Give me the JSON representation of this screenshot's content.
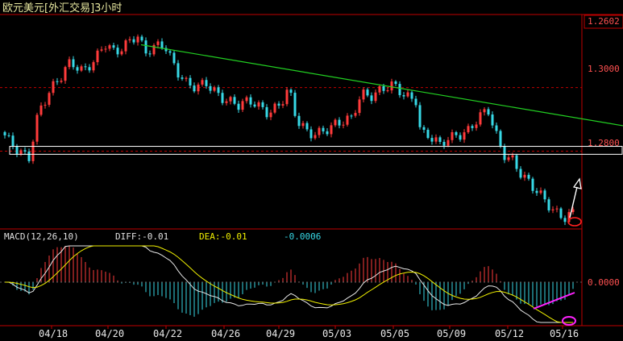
{
  "title": "欧元美元[外汇交易]3小时",
  "colors": {
    "frame": "#c00000",
    "up": "#ff3b3b",
    "down": "#37d9e6",
    "trendline": "#22d022",
    "diff": "#e8e8e8",
    "dea": "#f0f000",
    "title": "#e8e8a0",
    "macd_label": "#e0e0e0",
    "diff_label": "#e0e0e0",
    "dea_label": "#f0f000",
    "macd_value_label": "#37d9e6",
    "price_axis": "#ff5050",
    "annotation_white": "#ffffff",
    "annotation_magenta": "#ff22ff"
  },
  "chart_data": [
    {
      "type": "candlestick",
      "title": "欧元美元[外汇交易]3小时",
      "current_price": "1.2602",
      "y_ticks": [
        "1.3000",
        "1.2800"
      ],
      "ylim": [
        1.256,
        1.322
      ],
      "x_tick_labels": [
        "04/18",
        "04/20",
        "04/22",
        "04/26",
        "04/29",
        "05/03",
        "05/05",
        "05/09",
        "05/12",
        "05/16"
      ],
      "grid": "dashed horizontal at 1.3000 and 1.2800",
      "trendline": {
        "from": {
          "bar": 0.48,
          "price": 1.3135
        },
        "to": {
          "bar": 1.0,
          "price": 1.288
        }
      },
      "support_band": [
        1.279,
        1.2815
      ]
    },
    {
      "type": "line+bar",
      "name": "MACD(12,26,10)",
      "label": "MACD(12,26,10)",
      "diff_label": "DIFF:-0.01",
      "dea_label": "DEA:-0.01",
      "macd_value": "-0.0006",
      "y_tick": "0.0000",
      "series": [
        "DIFF",
        "DEA",
        "MACD"
      ]
    }
  ]
}
